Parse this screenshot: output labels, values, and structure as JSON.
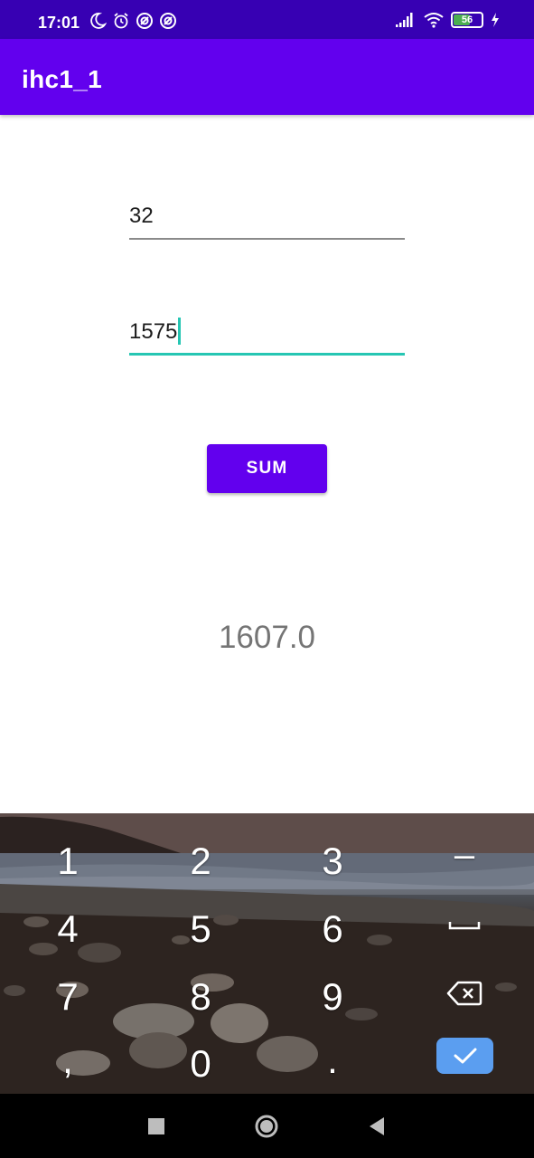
{
  "status_bar": {
    "time": "17:01",
    "battery_level": "56",
    "icons_left": [
      "moon-icon",
      "alarm-icon",
      "notification-icon",
      "notification-icon"
    ],
    "icons_right": [
      "signal-icon",
      "wifi-icon",
      "battery-icon",
      "charging-icon"
    ]
  },
  "app_bar": {
    "title": "ihc1_1",
    "color": "#6200ee"
  },
  "form": {
    "first_number": "32",
    "second_number": "1575",
    "sum_label": "SUM",
    "result": "1607.0",
    "focus_color": "#26c6b3"
  },
  "keyboard": {
    "rows": [
      [
        "1",
        "2",
        "3",
        "-"
      ],
      [
        "4",
        "5",
        "6",
        "space-icon"
      ],
      [
        "7",
        "8",
        "9",
        "backspace-icon"
      ],
      [
        ",",
        "0",
        ".",
        "check-icon"
      ]
    ],
    "keys": {
      "k1": "1",
      "k2": "2",
      "k3": "3",
      "minus": "–",
      "k4": "4",
      "k5": "5",
      "k6": "6",
      "k7": "7",
      "k8": "8",
      "k9": "9",
      "comma": ",",
      "k0": "0",
      "dot": "."
    },
    "enter_color": "#5b9ef0"
  },
  "nav_bar": {
    "buttons": [
      "recents-icon",
      "home-icon",
      "back-icon"
    ]
  }
}
